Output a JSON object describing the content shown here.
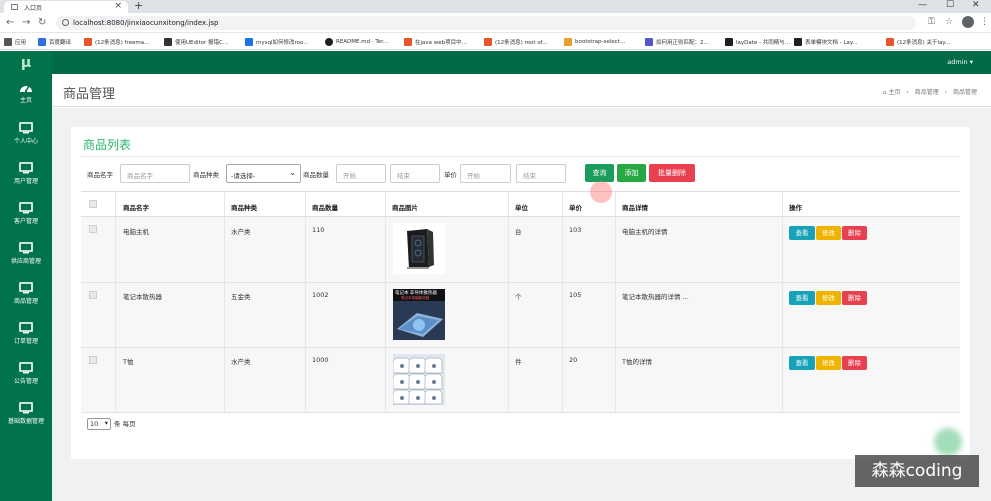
{
  "browser": {
    "tab_title": "入口页",
    "url": "localhost:8080/jinxiaocunxitong/index.jsp",
    "bookmarks": [
      {
        "label": "应用",
        "color": "#4a4a4a"
      },
      {
        "label": "百度翻译",
        "color": "#2d72d9"
      },
      {
        "label": "(12条消息) freema...",
        "color": "#e8552d"
      },
      {
        "label": "使用UEditor 报错C...",
        "color": "#333333"
      },
      {
        "label": "mysql如何修改roo...",
        "color": "#1a73e8"
      },
      {
        "label": "README.md · Ter...",
        "color": "#1f1f1f"
      },
      {
        "label": "在java web项目中...",
        "color": "#e8552d"
      },
      {
        "label": "(12条消息) root of...",
        "color": "#e8552d"
      },
      {
        "label": "bootstrap-select...",
        "color": "#e8a02d"
      },
      {
        "label": "如何用正则匹配：2...",
        "color": "#5555cc"
      },
      {
        "label": "layDate - 共同精与...",
        "color": "#1f1f1f"
      },
      {
        "label": "表单模块文档 - Lay...",
        "color": "#1f1f1f"
      },
      {
        "label": "(12条消息) 关于lay...",
        "color": "#e8552d"
      }
    ]
  },
  "sidebar": {
    "logo": "μ",
    "items": [
      {
        "label": "主页",
        "icon": "dashboard-icon"
      },
      {
        "label": "个人中心",
        "icon": "monitor-icon"
      },
      {
        "label": "用户管理",
        "icon": "monitor-icon"
      },
      {
        "label": "客户管理",
        "icon": "monitor-icon"
      },
      {
        "label": "供应商管理",
        "icon": "monitor-icon"
      },
      {
        "label": "商品管理",
        "icon": "monitor-icon"
      },
      {
        "label": "订单管理",
        "icon": "monitor-icon"
      },
      {
        "label": "公告管理",
        "icon": "monitor-icon"
      },
      {
        "label": "基础数据管理",
        "icon": "monitor-icon"
      }
    ]
  },
  "topbar": {
    "user": "admin ▾"
  },
  "header": {
    "title": "商品管理",
    "breadcrumb": {
      "home": "主页",
      "sep": "›",
      "level1": "商品管理",
      "level2": "商品管理"
    }
  },
  "card": {
    "title": "商品列表"
  },
  "filters": {
    "name_label": "商品名字",
    "name_placeholder": "商品名字",
    "type_label": "商品种类",
    "type_value": "-请选择-",
    "qty_label": "商品数量",
    "qty_start": "开始",
    "qty_end": "结束",
    "price_label": "单价",
    "price_start": "开始",
    "price_end": "结束"
  },
  "buttons": {
    "search": "查询",
    "add": "添加",
    "batch_delete": "批量删除"
  },
  "table": {
    "headers": [
      "商品名字",
      "商品种类",
      "商品数量",
      "商品图片",
      "单位",
      "单价",
      "商品详情",
      "操作"
    ],
    "rows": [
      {
        "name": "电脑主机",
        "type": "水产类",
        "qty": "110",
        "unit": "台",
        "price": "103",
        "detail": "电脑主机的详情",
        "image": "computer-case"
      },
      {
        "name": "笔记本散热器",
        "type": "五金类",
        "qty": "1002",
        "unit": "个",
        "price": "105",
        "detail": "笔记本散热器的详情 ...",
        "image": "laptop-cooler"
      },
      {
        "name": "T恤",
        "type": "水产类",
        "qty": "1000",
        "unit": "件",
        "price": "20",
        "detail": "T恤的详情",
        "image": "tshirts"
      }
    ],
    "actions": {
      "view": "查看",
      "edit": "修改",
      "delete": "删除"
    }
  },
  "pager": {
    "page_size": "10",
    "suffix": "条 每页"
  },
  "thumb_texts": {
    "cooler_title": "笔记本 非导体散热器",
    "cooler_sub": "笔记本电脑散热器"
  },
  "watermark": "森森coding",
  "colors": {
    "sidebar": "#00734a",
    "topbar": "#006b45",
    "title_green": "#2bb56b",
    "search_btn": "#1a9c5c",
    "add_btn": "#28a745",
    "delete_btn": "#e8404f",
    "view_btn": "#17a2b8",
    "edit_btn": "#f0b400"
  }
}
